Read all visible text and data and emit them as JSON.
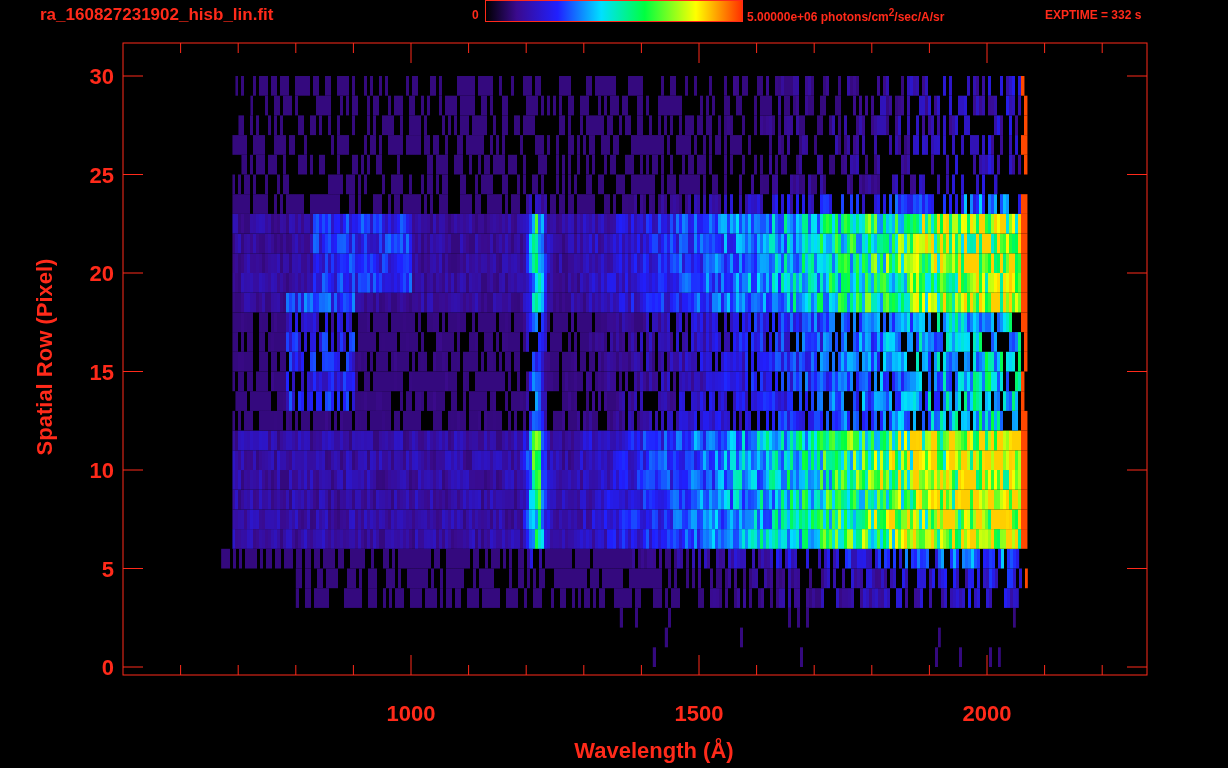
{
  "header": {
    "filename": "ra_160827231902_hisb_lin.fit",
    "colorbar": {
      "min_label": "0",
      "max_label": "5.00000e+06 photons/cm$^{2}$/sec/A/sr"
    },
    "exposure": "EXPTIME = 332 s"
  },
  "plot": {
    "y_axis": {
      "title": "Spatial Row (Pixel)",
      "ticks": [
        "30",
        "25",
        "20",
        "15",
        "10",
        "5",
        "0"
      ]
    },
    "x_axis": {
      "title": "Wavelength (Å)",
      "ticks": [
        "1000",
        "1500",
        "2000"
      ]
    }
  }
}
